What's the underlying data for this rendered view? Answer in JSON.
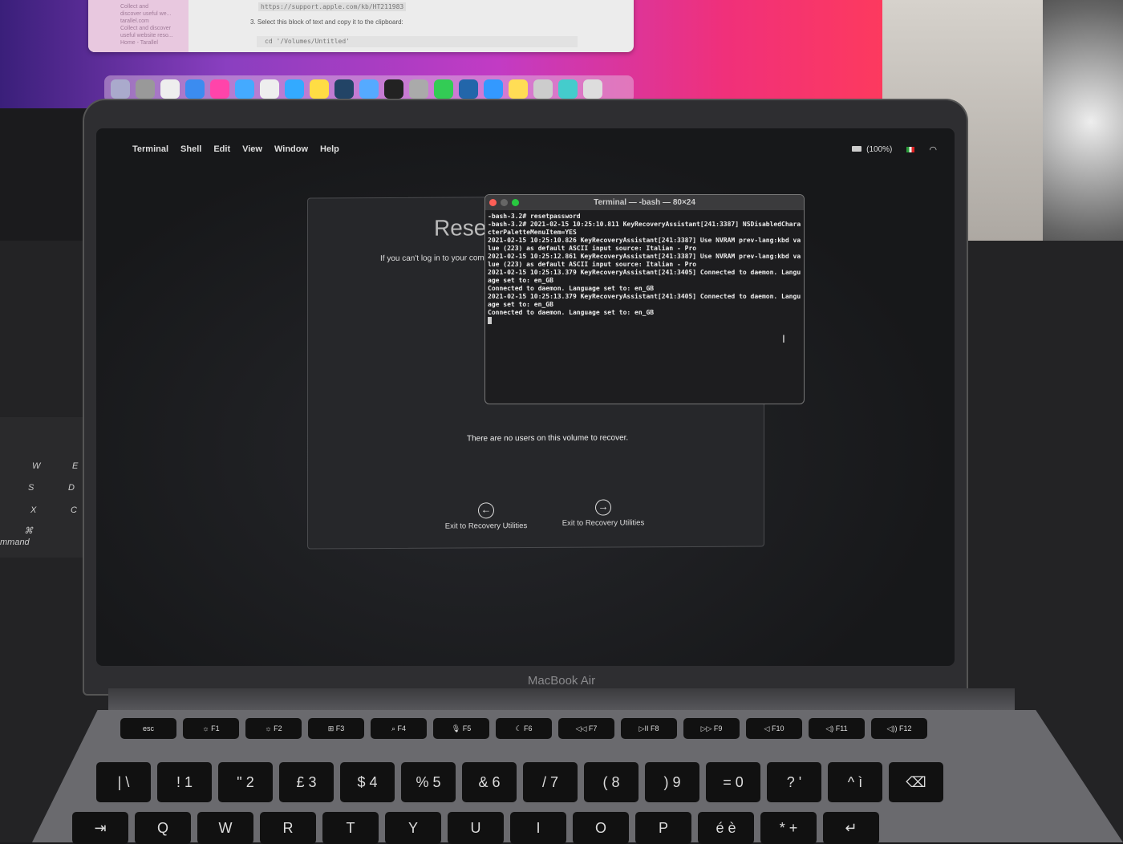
{
  "background_monitor": {
    "sidebar_text": [
      "Collect and",
      "discover useful we...",
      "tarallel.com",
      "Collect and discover",
      "useful website reso...",
      "Home - Tarallel"
    ],
    "url": "https://support.apple.com/kb/HT211983",
    "step": "3. Select this block of text and copy it to the clipboard:",
    "code": "cd '/Volumes/Untitled'",
    "dock_colors": [
      "#aac",
      "#999",
      "#eee",
      "#3b8cf0",
      "#f4a",
      "#4af",
      "#eee",
      "#3af",
      "#fd4",
      "#246",
      "#5af",
      "#222",
      "#aaa",
      "#3c5",
      "#26a",
      "#39f",
      "#fd5",
      "#ccc",
      "#4cc",
      "#ddd"
    ]
  },
  "menubar": {
    "apple": "",
    "items": [
      "Terminal",
      "Shell",
      "Edit",
      "View",
      "Window",
      "Help"
    ],
    "battery": "(100%)"
  },
  "dialog": {
    "title": "Reset",
    "subtitle": "If you can't log in to your com",
    "message": "There are no users on this volume to recover.",
    "back_button": "Exit to Recovery Utilities",
    "next_button": "Exit to Recovery Utilities"
  },
  "terminal": {
    "title": "Terminal — -bash — 80×24",
    "lines": [
      "-bash-3.2# resetpassword",
      "-bash-3.2# 2021-02-15 10:25:10.811 KeyRecoveryAssistant[241:3387] NSDisabledCharacterPaletteMenuItem=YES",
      "2021-02-15 10:25:10.826 KeyRecoveryAssistant[241:3387] Use NVRAM prev-lang:kbd value (223) as default ASCII input source: Italian - Pro",
      "2021-02-15 10:25:12.861 KeyRecoveryAssistant[241:3387] Use NVRAM prev-lang:kbd value (223) as default ASCII input source: Italian - Pro",
      "2021-02-15 10:25:13.379 KeyRecoveryAssistant[241:3405] Connected to daemon. Language set to: en_GB",
      "Connected to daemon. Language set to: en_GB",
      "2021-02-15 10:25:13.379 KeyRecoveryAssistant[241:3405] Connected to daemon. Language set to: en_GB",
      "Connected to daemon. Language set to: en_GB"
    ]
  },
  "laptop_brand": "MacBook Air",
  "keyboard": {
    "left_keys": [
      "W",
      "E",
      "S",
      "D",
      "X",
      "C",
      "⌘",
      "mmand"
    ],
    "function_row": [
      "esc",
      "☼ F1",
      "☼ F2",
      "⊞ F3",
      "⌕ F4",
      "🎙 F5",
      "☾ F6",
      "◁◁ F7",
      "▷II F8",
      "▷▷ F9",
      "◁ F10",
      "◁) F11",
      "◁)) F12"
    ],
    "number_row": [
      "| \\",
      "! 1",
      "\" 2",
      "£ 3",
      "$ 4",
      "% 5",
      "& 6",
      "/ 7",
      "( 8",
      ") 9",
      "= 0",
      "? '",
      "^ ì",
      "⌫"
    ],
    "letter_row": [
      "⇥",
      "Q",
      "W",
      "R",
      "T",
      "Y",
      "U",
      "I",
      "O",
      "P",
      "é è",
      "* +",
      "↵"
    ]
  }
}
